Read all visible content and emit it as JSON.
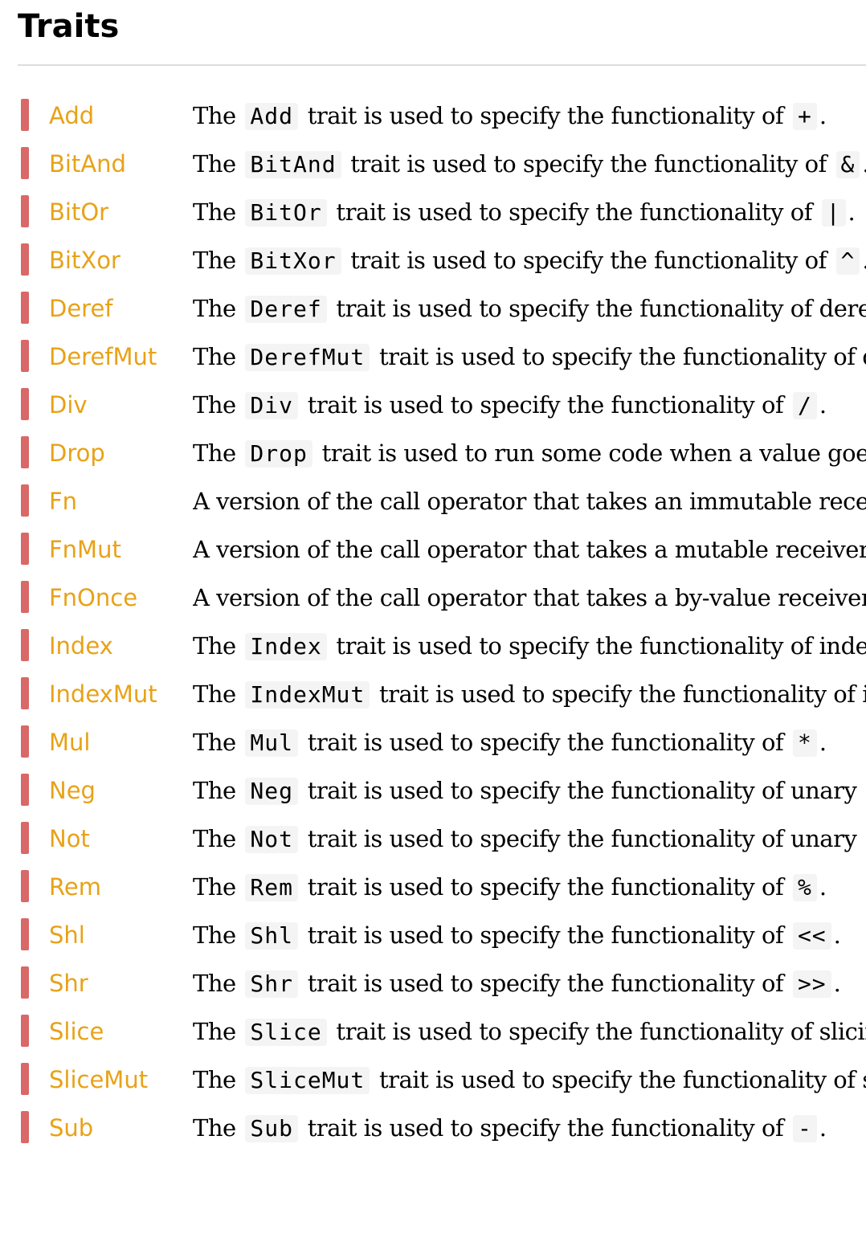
{
  "page_title": "Traits",
  "colors": {
    "link": "#e8a217",
    "marker": "#d96868",
    "code_bg": "#f4f4f4"
  },
  "traits": [
    {
      "name": "Add",
      "pre": "The",
      "code": "Add",
      "post": "trait is used to specify the functionality of",
      "code2": "+",
      "end": "."
    },
    {
      "name": "BitAnd",
      "pre": "The",
      "code": "BitAnd",
      "post": "trait is used to specify the functionality of",
      "code2": "&",
      "end": "."
    },
    {
      "name": "BitOr",
      "pre": "The",
      "code": "BitOr",
      "post": "trait is used to specify the functionality of",
      "code2": "|",
      "end": "."
    },
    {
      "name": "BitXor",
      "pre": "The",
      "code": "BitXor",
      "post": "trait is used to specify the functionality of",
      "code2": "^",
      "end": "."
    },
    {
      "name": "Deref",
      "pre": "The",
      "code": "Deref",
      "post": "trait is used to specify the functionality of dere",
      "code2": "",
      "end": ""
    },
    {
      "name": "DerefMut",
      "pre": "The",
      "code": "DerefMut",
      "post": "trait is used to specify the functionality of d",
      "code2": "",
      "end": ""
    },
    {
      "name": "Div",
      "pre": "The",
      "code": "Div",
      "post": "trait is used to specify the functionality of",
      "code2": "/",
      "end": "."
    },
    {
      "name": "Drop",
      "pre": "The",
      "code": "Drop",
      "post": "trait is used to run some code when a value goes",
      "code2": "",
      "end": ""
    },
    {
      "name": "Fn",
      "pre": "A version of the call operator that takes an immutable recei",
      "code": "",
      "post": "",
      "code2": "",
      "end": ""
    },
    {
      "name": "FnMut",
      "pre": "A version of the call operator that takes a mutable receiver.",
      "code": "",
      "post": "",
      "code2": "",
      "end": ""
    },
    {
      "name": "FnOnce",
      "pre": "A version of the call operator that takes a by-value receiver.",
      "code": "",
      "post": "",
      "code2": "",
      "end": ""
    },
    {
      "name": "Index",
      "pre": "The",
      "code": "Index",
      "post": "trait is used to specify the functionality of inde",
      "code2": "",
      "end": ""
    },
    {
      "name": "IndexMut",
      "pre": "The",
      "code": "IndexMut",
      "post": "trait is used to specify the functionality of i",
      "code2": "",
      "end": ""
    },
    {
      "name": "Mul",
      "pre": "The",
      "code": "Mul",
      "post": "trait is used to specify the functionality of",
      "code2": "*",
      "end": "."
    },
    {
      "name": "Neg",
      "pre": "The",
      "code": "Neg",
      "post": "trait is used to specify the functionality of unary",
      "code2": "-",
      "end": ""
    },
    {
      "name": "Not",
      "pre": "The",
      "code": "Not",
      "post": "trait is used to specify the functionality of unary",
      "code2": "!",
      "end": ""
    },
    {
      "name": "Rem",
      "pre": "The",
      "code": "Rem",
      "post": "trait is used to specify the functionality of",
      "code2": "%",
      "end": "."
    },
    {
      "name": "Shl",
      "pre": "The",
      "code": "Shl",
      "post": "trait is used to specify the functionality of",
      "code2": "<<",
      "end": "."
    },
    {
      "name": "Shr",
      "pre": "The",
      "code": "Shr",
      "post": "trait is used to specify the functionality of",
      "code2": ">>",
      "end": "."
    },
    {
      "name": "Slice",
      "pre": "The",
      "code": "Slice",
      "post": "trait is used to specify the functionality of slicin",
      "code2": "",
      "end": ""
    },
    {
      "name": "SliceMut",
      "pre": "The",
      "code": "SliceMut",
      "post": "trait is used to specify the functionality of s",
      "code2": "",
      "end": ""
    },
    {
      "name": "Sub",
      "pre": "The",
      "code": "Sub",
      "post": "trait is used to specify the functionality of",
      "code2": "-",
      "end": "."
    }
  ]
}
